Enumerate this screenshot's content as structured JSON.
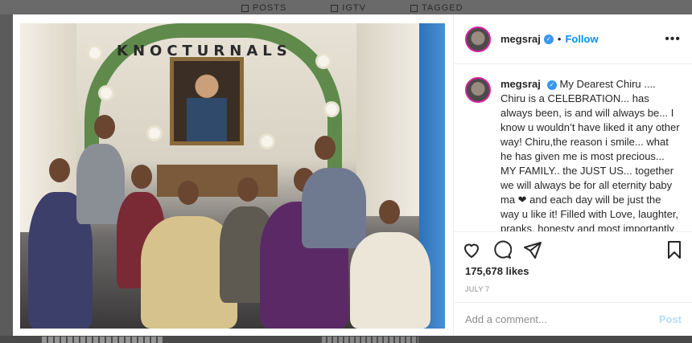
{
  "profile_tabs": [
    {
      "label": "POSTS",
      "icon": "grid-icon"
    },
    {
      "label": "IGTV",
      "icon": "igtv-icon"
    },
    {
      "label": "TAGGED",
      "icon": "tag-icon"
    }
  ],
  "post": {
    "image_watermark": "KNOCTURNALS",
    "username": "megsraj",
    "verified": true,
    "follow_label": "Follow",
    "more_icon": "more-icon",
    "caption": "My Dearest Chiru .... Chiru is a CELEBRATION... has always been, is and will always be... I know u wouldn’t have liked it any other way! Chiru,the reason i smile... what he has given me is most precious... MY FAMILY.. the JUST US... together we will always be for all eternity baby ma ❤ and each day will be just the way u like it! Filled with Love, laughter, pranks, honesty and most importantly",
    "likes": "175,678 likes",
    "date": "JULY 7",
    "actions": [
      "heart-icon",
      "comment-icon",
      "share-icon",
      "bookmark-icon"
    ],
    "comment_placeholder": "Add a comment...",
    "post_label": "Post"
  },
  "colors": {
    "link_blue": "#0095f6",
    "verified_blue": "#3897f0",
    "post_disabled": "#b2dffc",
    "text": "#262626",
    "muted": "#8e8e8e"
  }
}
